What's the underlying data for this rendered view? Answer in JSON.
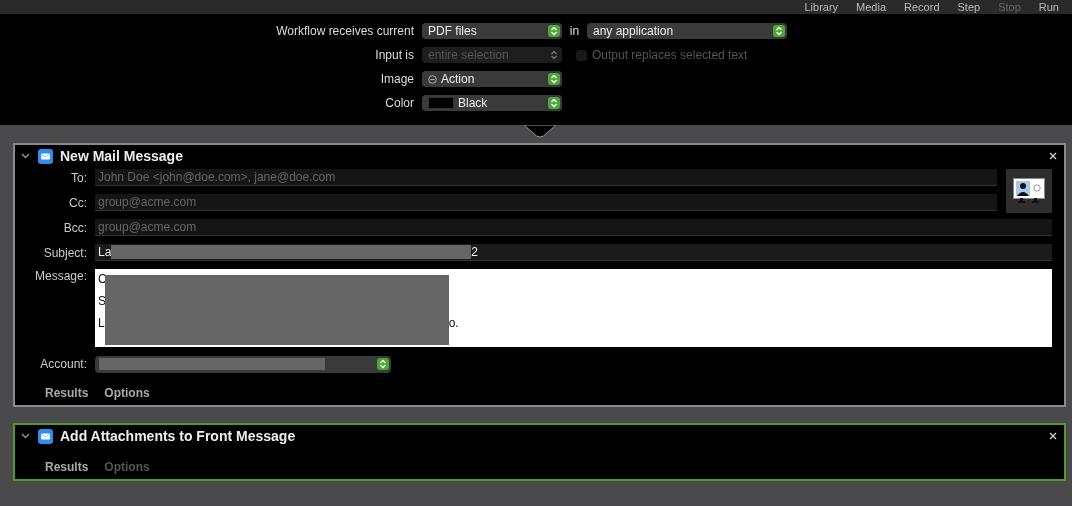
{
  "toolbar": [
    {
      "label": "Library",
      "disabled": false
    },
    {
      "label": "Media",
      "disabled": false
    },
    {
      "label": "Record",
      "disabled": false
    },
    {
      "label": "Step",
      "disabled": false
    },
    {
      "label": "Stop",
      "disabled": true
    },
    {
      "label": "Run",
      "disabled": false
    }
  ],
  "workflow": {
    "receives_label": "Workflow receives current",
    "receives_value": "PDF files",
    "in_label": "in",
    "in_value": "any application",
    "input_label": "Input is",
    "input_value": "entire selection",
    "input_disabled": true,
    "output_replaces": {
      "label": "Output replaces selected text",
      "checked": false,
      "disabled": true
    },
    "image_label": "Image",
    "image_value": "Action",
    "color_label": "Color",
    "color_value": "Black",
    "color": "#000000"
  },
  "actions": [
    {
      "kind": "mail",
      "title": "New Mail Message",
      "expanded": true,
      "selected": false,
      "fields": [
        {
          "label": "To:",
          "placeholder": "John Doe <john@doe.com>, jane@doe.com"
        },
        {
          "label": "Cc:",
          "placeholder": "group@acme.com"
        },
        {
          "label": "Bcc:",
          "placeholder": "group@acme.com"
        }
      ],
      "subject": {
        "label": "Subject:",
        "start": "La",
        "end": "2",
        "redacted": true
      },
      "message": {
        "label": "Message:",
        "lines": [
          {
            "start": "C"
          },
          {
            "start": "S"
          },
          {
            "start": "L",
            "end": "o."
          }
        ],
        "redacted": true
      },
      "account": {
        "label": "Account:",
        "redacted": true
      },
      "tabs": [
        {
          "label": "Results",
          "disabled": false
        },
        {
          "label": "Options",
          "disabled": false
        }
      ]
    },
    {
      "kind": "attach",
      "title": "Add Attachments to Front Message",
      "expanded": true,
      "selected": true,
      "tabs": [
        {
          "label": "Results",
          "disabled": false
        },
        {
          "label": "Options",
          "disabled": true
        }
      ]
    }
  ]
}
